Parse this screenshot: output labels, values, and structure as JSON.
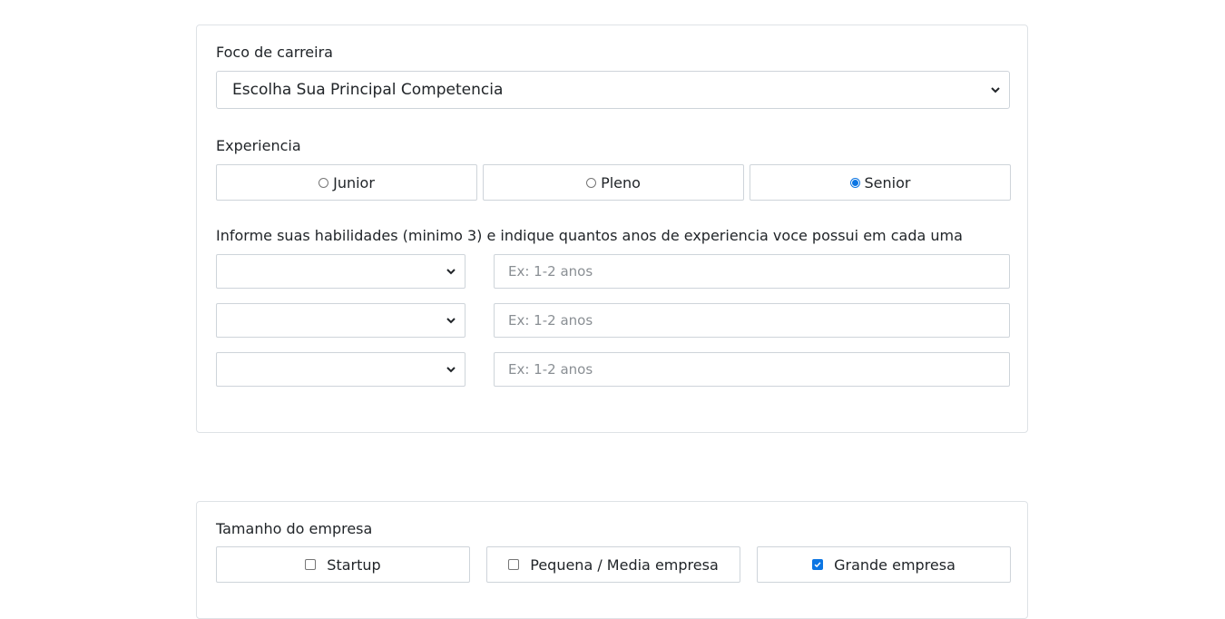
{
  "career": {
    "label": "Foco de carreira",
    "selected": "Escolha Sua Principal Competencia"
  },
  "experience": {
    "label": "Experiencia",
    "options": [
      {
        "label": "Junior",
        "checked": false
      },
      {
        "label": "Pleno",
        "checked": false
      },
      {
        "label": "Senior",
        "checked": true
      }
    ]
  },
  "skills": {
    "label": "Informe suas habilidades (minimo 3) e indique quantos anos de experiencia voce possui em cada uma",
    "rows": [
      {
        "skill": "",
        "years": "",
        "placeholder": "Ex: 1-2 anos"
      },
      {
        "skill": "",
        "years": "",
        "placeholder": "Ex: 1-2 anos"
      },
      {
        "skill": "",
        "years": "",
        "placeholder": "Ex: 1-2 anos"
      }
    ]
  },
  "company_size": {
    "label": "Tamanho do empresa",
    "options": [
      {
        "label": "Startup",
        "checked": false
      },
      {
        "label": "Pequena / Media empresa",
        "checked": false
      },
      {
        "label": "Grande empresa",
        "checked": true
      }
    ]
  },
  "colors": {
    "accent": "#0b75e3",
    "border": "#ced4da",
    "card_border": "#dee2e6"
  },
  "icons": {
    "select_arrow": "chevron-down-icon",
    "checkmark": "check-icon"
  }
}
